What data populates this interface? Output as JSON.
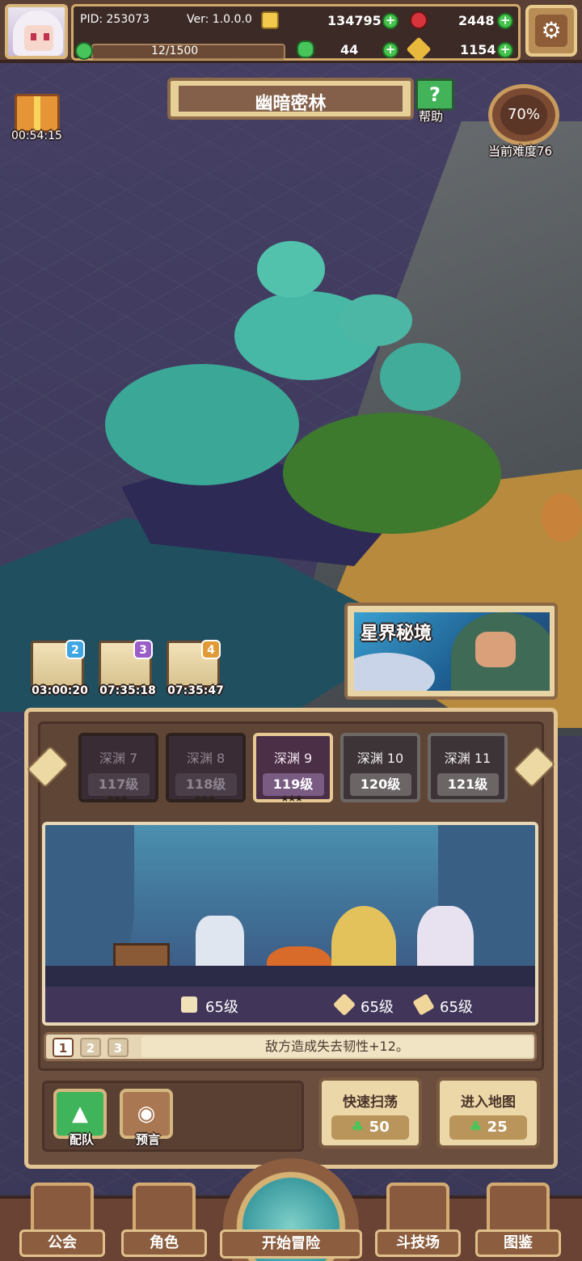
{
  "header": {
    "pid": "PID: 253073",
    "version": "Ver: 1.0.0.0",
    "gold": "134795",
    "red_gems": "2448",
    "stamina": "12/1500",
    "clovers": "44",
    "keys": "1154",
    "settings_icon": "gear-icon"
  },
  "area": {
    "title": "幽暗密林",
    "help_label": "帮助",
    "difficulty_percent": "70%",
    "difficulty_label": "当前难度76",
    "gift_timer": "00:54:15"
  },
  "chapters": [
    {
      "badge": "2",
      "timer": "03:00:20",
      "color": "#3fa6e2"
    },
    {
      "badge": "3",
      "timer": "07:35:18",
      "color": "#9a5cc8"
    },
    {
      "badge": "4",
      "timer": "07:35:47",
      "color": "#e09a36"
    }
  ],
  "portal": {
    "title": "星界秘境"
  },
  "tiers": [
    {
      "name": "深渊 7",
      "level": "117级",
      "state": "done"
    },
    {
      "name": "深渊 8",
      "level": "118级",
      "state": "done"
    },
    {
      "name": "深渊 9",
      "level": "119级",
      "state": "current"
    },
    {
      "name": "深渊 10",
      "level": "120级",
      "state": "locked"
    },
    {
      "name": "深渊 11",
      "level": "121级",
      "state": "locked"
    }
  ],
  "battle": {
    "stats": [
      {
        "icon": "dice-icon",
        "value": "65级"
      },
      {
        "icon": "wrench-icon",
        "value": "65级"
      },
      {
        "icon": "pickaxe-icon",
        "value": "65级"
      }
    ]
  },
  "effect": {
    "pages": [
      "1",
      "2",
      "3"
    ],
    "text": "敌方造成失去韧性+12。"
  },
  "actions": {
    "team_label": "配队",
    "preview_label": "预言",
    "sweep_label": "快速扫荡",
    "sweep_cost": "50",
    "enter_label": "进入地图",
    "enter_cost": "25"
  },
  "nav": {
    "guild": "公会",
    "character": "角色",
    "adventure": "开始冒险",
    "arena": "斗技场",
    "codex": "图鉴"
  }
}
